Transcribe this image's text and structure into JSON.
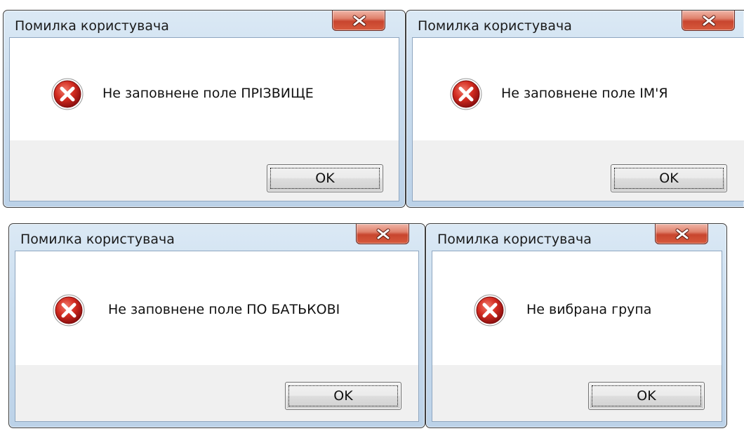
{
  "dialogs": [
    {
      "title": "Помилка користувача",
      "message": "Не заповнене поле ПРІЗВИЩЕ",
      "ok_label": "OK"
    },
    {
      "title": "Помилка користувача",
      "message": "Не заповнене поле ІМ'Я",
      "ok_label": "OK"
    },
    {
      "title": "Помилка користувача",
      "message": "Не заповнене поле ПО БАТЬКОВІ",
      "ok_label": "OK"
    },
    {
      "title": "Помилка користувача",
      "message": "Не вибрана група",
      "ok_label": "OK"
    }
  ],
  "icons": {
    "close": "close-icon",
    "error": "error-icon"
  },
  "colors": {
    "close_button": "#c8452e",
    "error_icon": "#c61f1f",
    "frame": "#bcd2e8",
    "button_area": "#f0f0f0"
  }
}
